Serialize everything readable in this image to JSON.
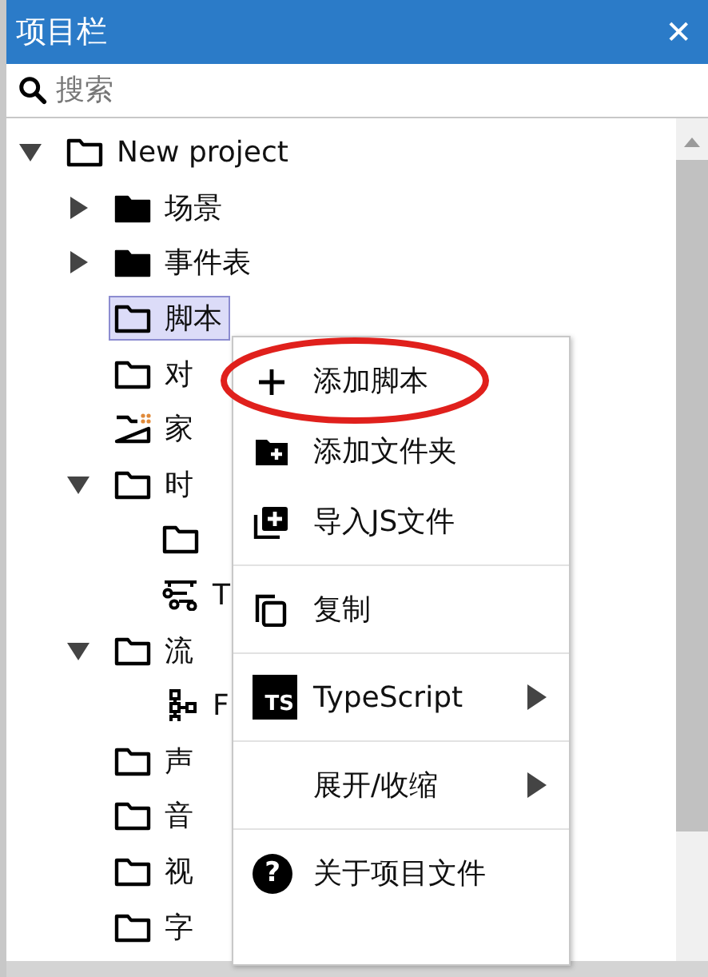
{
  "panel": {
    "title": "项目栏",
    "close": "✕"
  },
  "search": {
    "placeholder": "搜索"
  },
  "tree": [
    {
      "label": "New project",
      "kind": "folder",
      "expanded": true,
      "selected": false,
      "children": [
        {
          "label": "场景",
          "kind": "folder-filled",
          "expanded": false,
          "selected": false
        },
        {
          "label": "事件表",
          "kind": "folder-filled",
          "expanded": false,
          "selected": false
        },
        {
          "label": "脚本",
          "kind": "folder",
          "selected": true
        },
        {
          "label": "对",
          "kind": "folder",
          "selected": false
        },
        {
          "label": "家",
          "kind": "family",
          "selected": false
        },
        {
          "label": "时",
          "kind": "folder",
          "expanded": true,
          "selected": false,
          "children": [
            {
              "kind": "folder",
              "selected": false
            },
            {
              "label": "T",
              "kind": "timeline",
              "selected": false
            }
          ]
        },
        {
          "label": "流",
          "kind": "folder",
          "expanded": true,
          "selected": false,
          "children": [
            {
              "label": "F",
              "kind": "flow",
              "selected": false
            }
          ]
        },
        {
          "label": "声",
          "kind": "folder",
          "selected": false
        },
        {
          "label": "音",
          "kind": "folder",
          "selected": false
        },
        {
          "label": "视",
          "kind": "folder",
          "selected": false
        },
        {
          "label": "字",
          "kind": "folder",
          "selected": false
        }
      ]
    }
  ],
  "context_menu": {
    "groups": [
      [
        {
          "label": "添加脚本",
          "kind": "plus",
          "circled": true,
          "submenu": false
        },
        {
          "label": "添加文件夹",
          "kind": "folder-plus",
          "circled": false,
          "submenu": false
        },
        {
          "label": "导入JS文件",
          "kind": "import",
          "circled": false,
          "submenu": false
        }
      ],
      [
        {
          "label": "复制",
          "kind": "copy",
          "circled": false,
          "submenu": false
        }
      ],
      [
        {
          "label": "TypeScript",
          "kind": "badge",
          "badge": "TS",
          "circled": false,
          "submenu": true
        }
      ],
      [
        {
          "label": "展开/收缩",
          "kind": "none",
          "circled": false,
          "submenu": true
        }
      ],
      [
        {
          "label": "关于项目文件",
          "kind": "help",
          "glyph": "?",
          "circled": false,
          "submenu": false
        }
      ]
    ]
  }
}
